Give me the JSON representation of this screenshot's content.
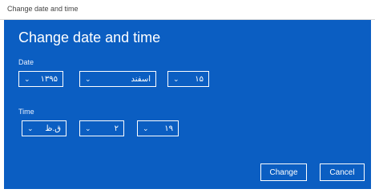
{
  "window": {
    "title": "Change date and time"
  },
  "dialog": {
    "heading": "Change date and time",
    "date": {
      "label": "Date",
      "year": "۱۳۹۵",
      "month": "اسفند",
      "day": "۱۵"
    },
    "time": {
      "label": "Time",
      "hour": "ق.ظ",
      "minute": "۲",
      "period": "۱۹"
    },
    "buttons": {
      "change": "Change",
      "cancel": "Cancel"
    }
  },
  "icons": {
    "dropdown": "chevron-down-icon"
  },
  "colors": {
    "accent": "#0b5ec2",
    "text": "#ffffff"
  }
}
